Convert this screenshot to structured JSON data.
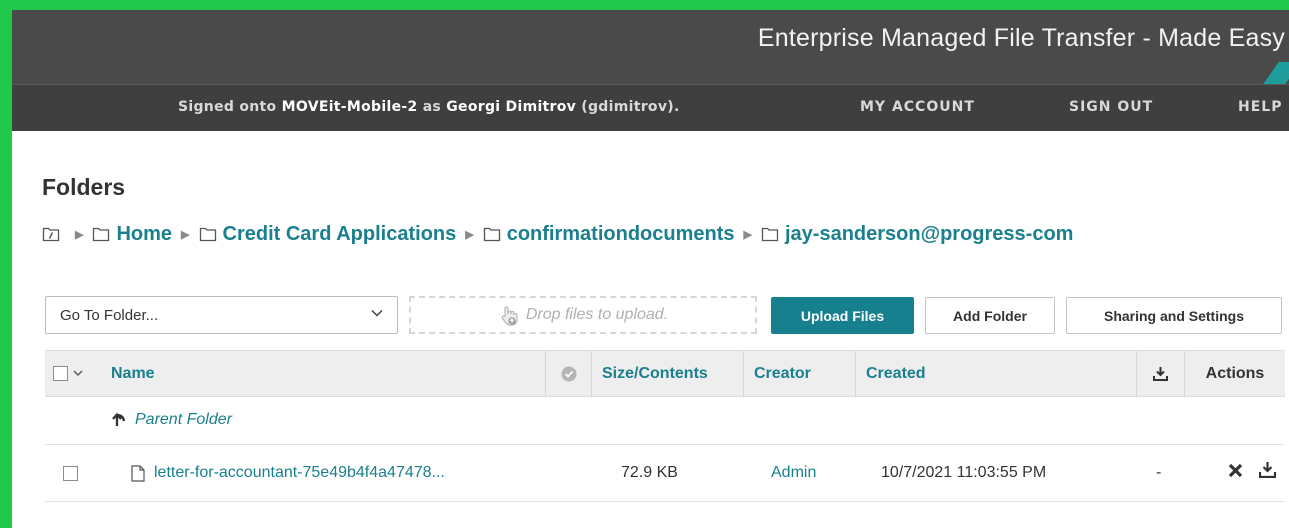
{
  "header": {
    "tagline": "Enterprise Managed File Transfer - Made Easy",
    "signed_prefix": "Signed onto ",
    "server": "MOVEit-Mobile-2",
    "as_text": " as ",
    "user_name": "Georgi Dimitrov",
    "user_id": " (gdimitrov).",
    "nav": {
      "my_account": "MY ACCOUNT",
      "sign_out": "SIGN OUT",
      "help": "HELP"
    },
    "accent_color": "#1f9c9c"
  },
  "page": {
    "title": "Folders",
    "breadcrumb": [
      "Home",
      "Credit Card Applications",
      "confirmationdocuments",
      "jay-sanderson@progress-com"
    ]
  },
  "toolbar": {
    "goto_value": "Go To Folder...",
    "drop_text": "Drop files to upload.",
    "upload_label": "Upload Files",
    "add_folder_label": "Add Folder",
    "sharing_label": "Sharing and Settings"
  },
  "table": {
    "columns": {
      "name": "Name",
      "size": "Size/Contents",
      "creator": "Creator",
      "created": "Created",
      "actions": "Actions"
    },
    "parent_folder": "Parent Folder",
    "rows": [
      {
        "name": "letter-for-accountant-75e49b4f4a47478...",
        "size": "72.9 KB",
        "creator": "Admin",
        "created": "10/7/2021 11:03:55 PM",
        "downloads": "-"
      }
    ]
  },
  "icons": [
    "folder-root-icon",
    "folder-icon",
    "chevron-down-icon",
    "hand-drop-icon",
    "check-circle-icon",
    "download-icon",
    "up-arrow-icon",
    "file-icon",
    "delete-icon"
  ],
  "colors": {
    "teal": "#16808f",
    "link": "#1a7f8e",
    "topbar": "#4a4a4a",
    "frame_border": "#1fc74a"
  }
}
